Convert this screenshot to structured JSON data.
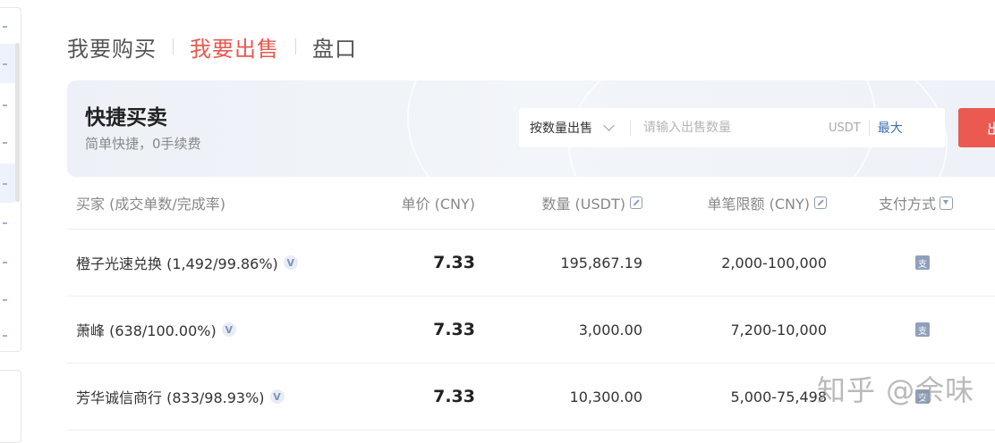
{
  "tabs": [
    {
      "label": "我要购买",
      "active": false
    },
    {
      "label": "我要出售",
      "active": true
    },
    {
      "label": "盘口",
      "active": false
    }
  ],
  "banner": {
    "title": "快捷买卖",
    "subtitle": "简单快捷，0手续费",
    "mode_label": "按数量出售",
    "qty_placeholder": "请输入出售数量",
    "unit": "USDT",
    "max_label": "最大",
    "submit_label": "出"
  },
  "table": {
    "headers": {
      "buyer": "买家 (成交单数/完成率)",
      "price": "单价 (CNY)",
      "qty": "数量 (USDT)",
      "limit": "单笔限额 (CNY)",
      "payment": "支付方式"
    },
    "rows": [
      {
        "buyer": "橙子光速兑换 (1,492/99.86%)",
        "price": "7.33",
        "qty": "195,867.19",
        "limit": "2,000-100,000",
        "payment_icon": "alipay-icon"
      },
      {
        "buyer": "萧峰 (638/100.00%)",
        "price": "7.33",
        "qty": "3,000.00",
        "limit": "7,200-10,000",
        "payment_icon": "alipay-icon"
      },
      {
        "buyer": "芳华诚信商行 (833/98.93%)",
        "price": "7.33",
        "qty": "10,300.00",
        "limit": "5,000-75,498",
        "payment_icon": "alipay-icon"
      }
    ],
    "verified_badge": "V",
    "pay_glyph": "支"
  },
  "watermark": "知乎 @余味",
  "colors": {
    "accent": "#ea5a50",
    "link": "#3d6fb6",
    "badge": "#8fa0bd"
  }
}
